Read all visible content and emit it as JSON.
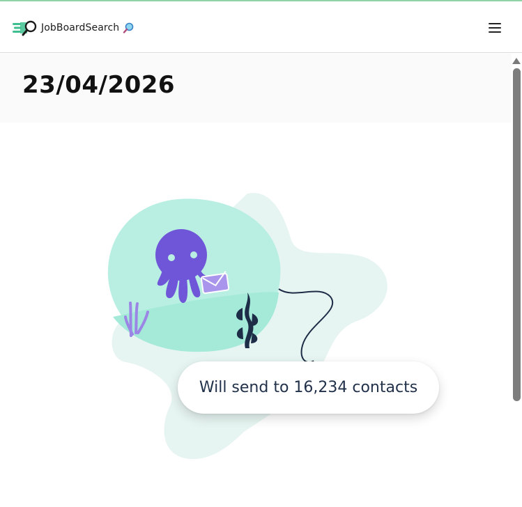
{
  "header": {
    "brand_name": "JobBoardSearch",
    "logo_icon": "speed-magnifier-logo",
    "brand_emoji_icon": "magnifying-glass-icon",
    "menu_icon": "hamburger-menu-icon"
  },
  "page": {
    "date_title": "23/04/2026",
    "send_message": "Will send to 16,234 contacts"
  },
  "illustration": {
    "icon": "octopus-envelope-illustration"
  },
  "colors": {
    "top_accent": "#8fd3a6",
    "logo_green": "#3fbf8f",
    "octopus_purple": "#6f56d8",
    "blob_teal": "#b8efe2",
    "blob_light": "#e7f5f2",
    "seaweed_navy": "#1e2d47",
    "text_dark": "#22314a"
  }
}
